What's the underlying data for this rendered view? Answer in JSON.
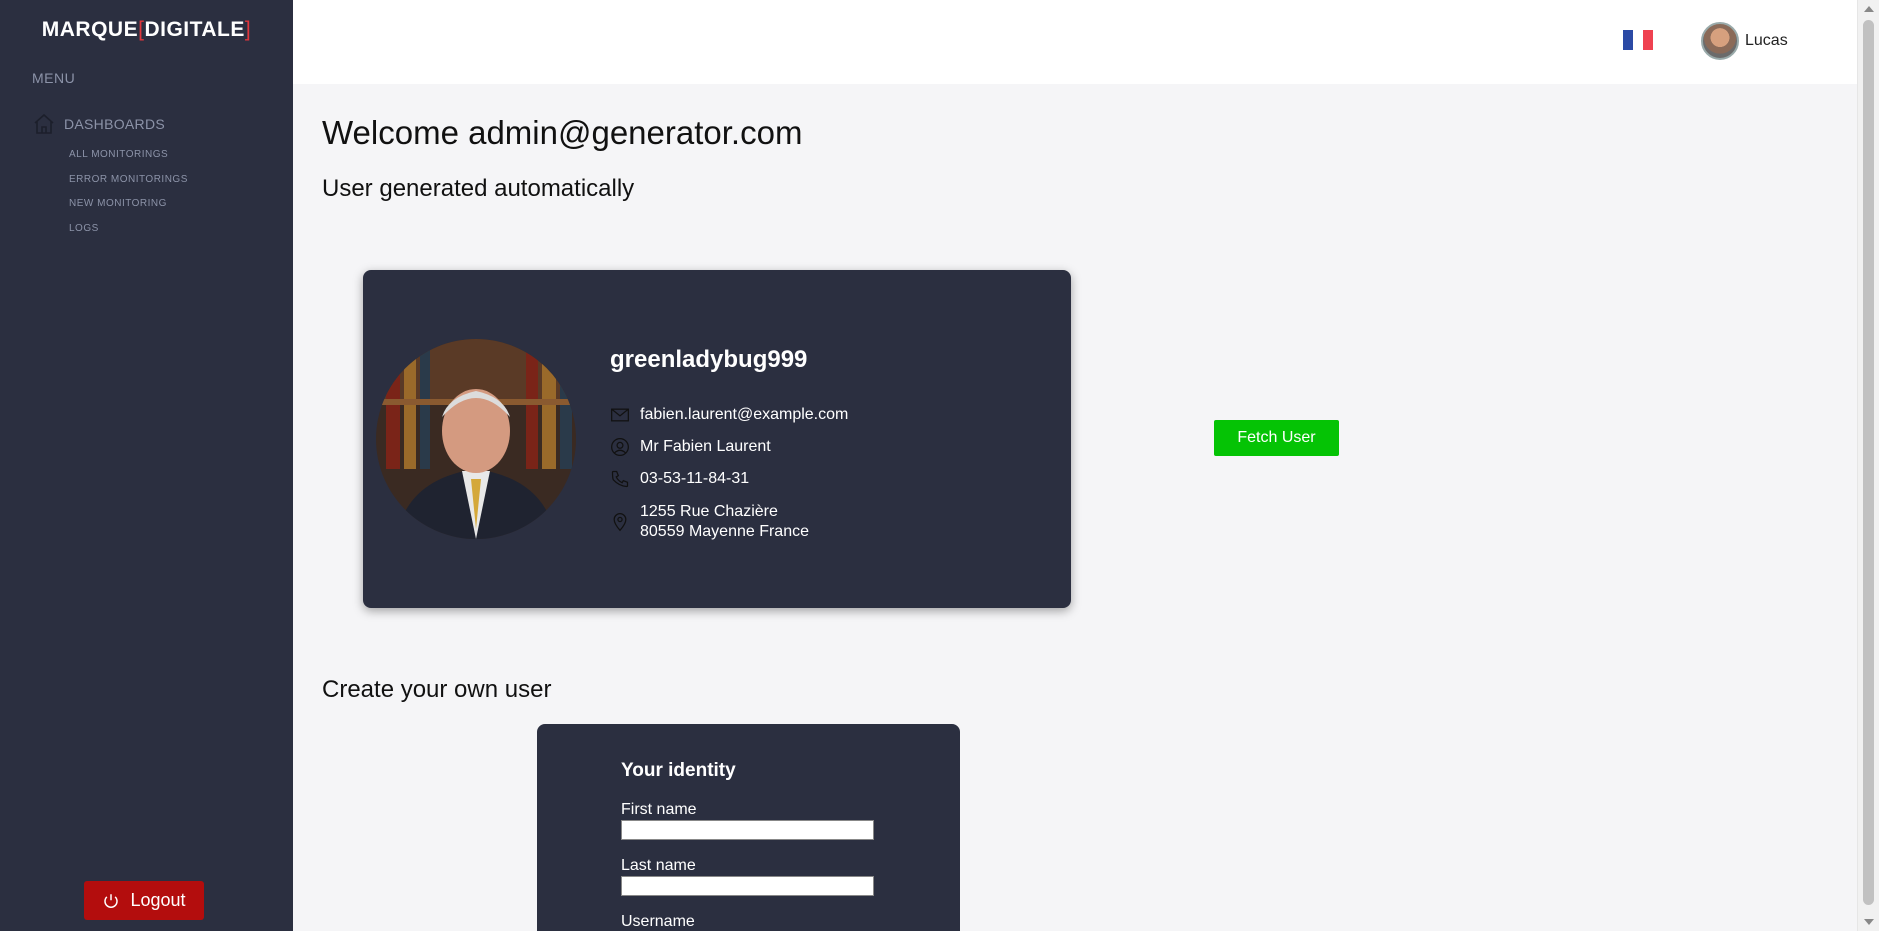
{
  "brand": {
    "left": "MARQUE",
    "bracket_open": "[",
    "mid": "DIGITALE",
    "bracket_close": "]"
  },
  "sidebar": {
    "menu_title": "MENU",
    "dashboards_label": "DASHBOARDS",
    "items": [
      {
        "label": "ALL MONITORINGS"
      },
      {
        "label": "ERROR MONITORINGS"
      },
      {
        "label": "NEW MONITORING"
      },
      {
        "label": "LOGS"
      }
    ],
    "logout_label": "Logout"
  },
  "topbar": {
    "language_flag": "france-flag",
    "user_name": "Lucas"
  },
  "main": {
    "welcome": "Welcome admin@generator.com",
    "auto_heading": "User generated automatically",
    "create_heading": "Create your own user"
  },
  "user_card": {
    "username": "greenladybug999",
    "email": "fabien.laurent@example.com",
    "full_name": "Mr Fabien Laurent",
    "phone": "03-53-11-84-31",
    "address_line1": "1255 Rue Chazière",
    "address_line2": "80559 Mayenne France"
  },
  "fetch_button": "Fetch User",
  "form": {
    "title": "Your identity",
    "first_name_label": "First name",
    "first_name_value": "",
    "last_name_label": "Last name",
    "last_name_value": "",
    "username_label": "Username"
  },
  "colors": {
    "sidebar_bg": "#2b2f40",
    "accent_red": "#e0363c",
    "logout_red": "#b30d0d",
    "fetch_green": "#05c305",
    "page_bg": "#f5f5f7"
  }
}
